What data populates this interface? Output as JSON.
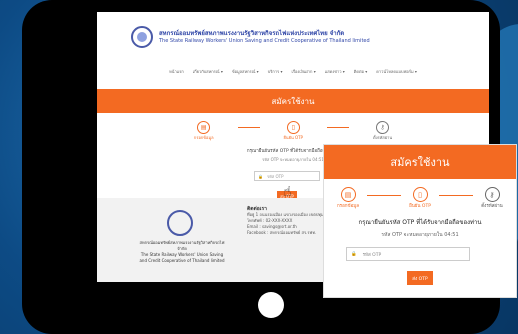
{
  "header": {
    "org_th": "สหกรณ์ออมทรัพย์สหภาพแรงงานรัฐวิสาหกิจรถไฟแห่งประเทศไทย จำกัด",
    "org_en": "The State Railway Workers' Union Saving and Credit Cooperative of Thailand limited"
  },
  "nav": [
    "หน้าแรก",
    "เกี่ยวกับสหกรณ์ ▾",
    "ข้อมูลสหกรณ์ ▾",
    "บริการ ▾",
    "เรื่องเงินฝาก ▾",
    "แสดงข่าว ▾",
    "ติดต่อ ▾",
    "ดาวน์โหลดแบบฟอร์ม ▾"
  ],
  "page": {
    "title": "สมัครใช้งาน"
  },
  "steps": [
    "กรอกข้อมูล",
    "ยืนยัน OTP",
    "ตั้งรหัสผ่าน"
  ],
  "otp": {
    "message": "กรุณายืนยันรหัส OTP ที่ได้รับจากมือถือของท่าน",
    "countdown": "รหัส OTP จะหมดอายุภายใน 04:51",
    "input_placeholder": "รหัส OTP",
    "button_label": "ส่ง OTP"
  },
  "footer": {
    "org_th": "สหกรณ์ออมทรัพย์สหภาพแรงงานรัฐวิสาหกิจรถไฟ จำกัด",
    "org_en": "The State Railway Workers' Union Saving and Credit Cooperative of Thailand limited",
    "contact_title": "ติดต่อเรา",
    "address": "ที่อยู่ 1 ถนนรองเมือง แขวงรองเมือง เขตปทุมวัน กรุงเทพฯ",
    "phone": "โทรศัพท์ : 02-XXX-XXXX",
    "email": "Email : savings@srt.or.th",
    "facebook": "Facebook : สหกรณ์ออมทรัพย์ สร.รฟท."
  },
  "colors": {
    "accent": "#f36a22",
    "background": "#0d4b85"
  }
}
